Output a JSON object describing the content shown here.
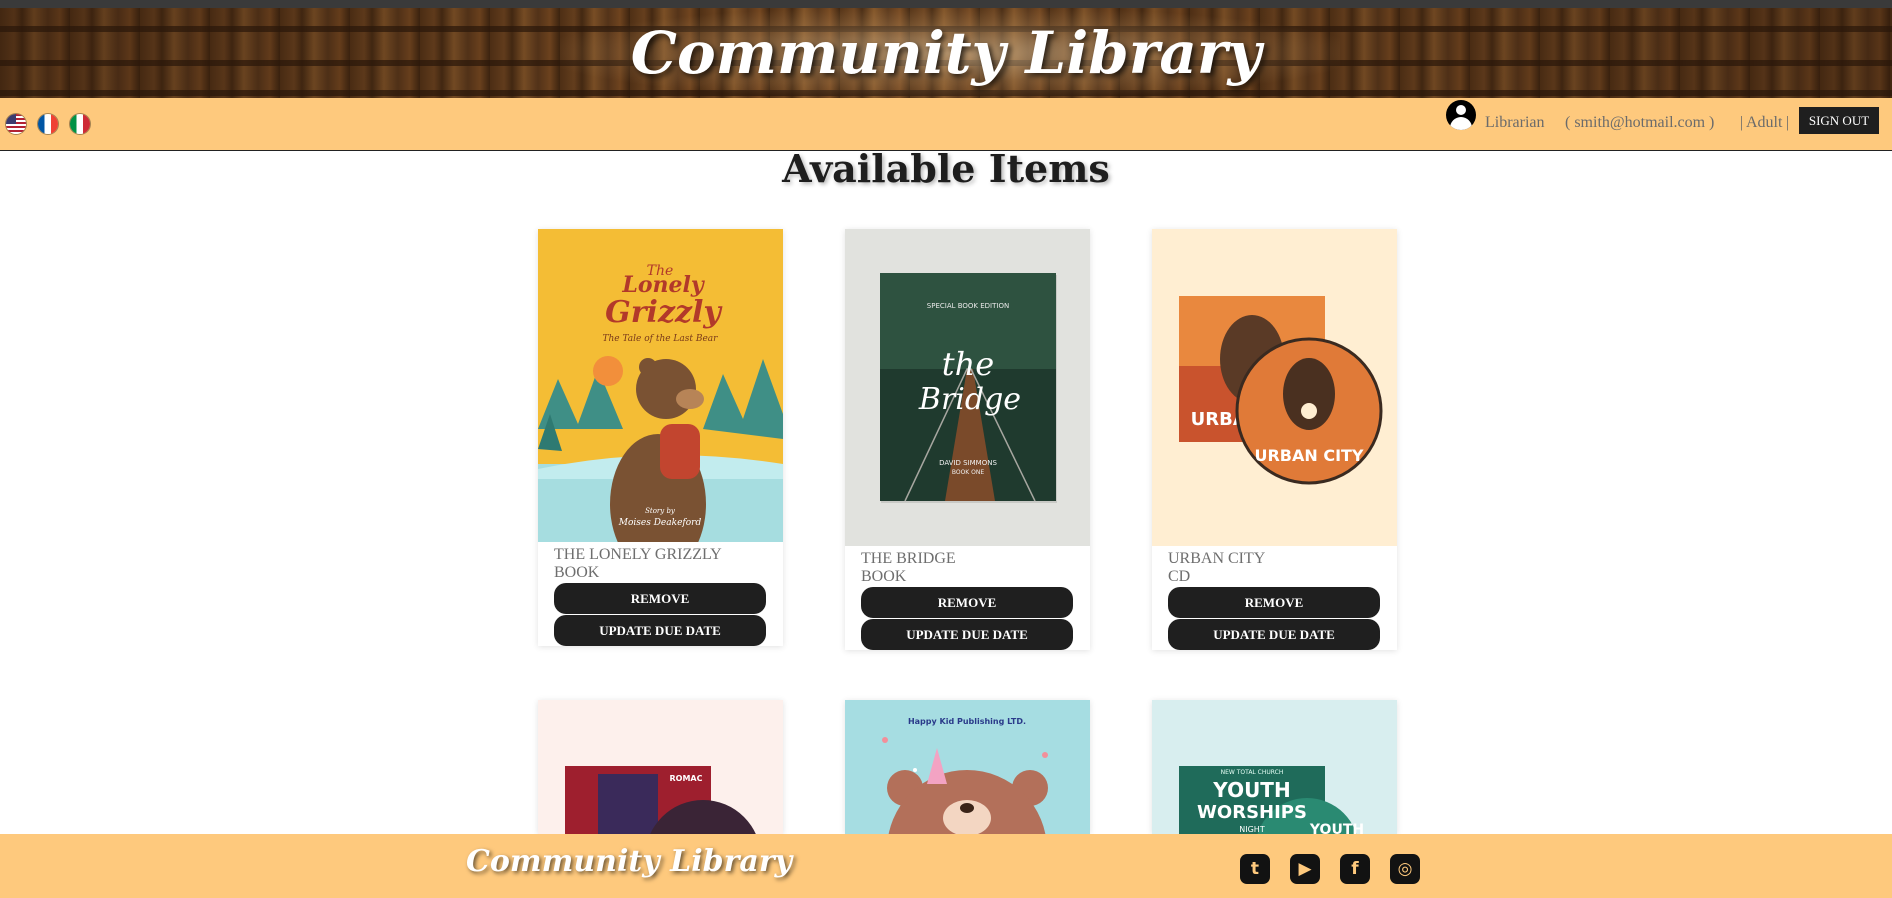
{
  "header": {
    "site_title": "Community Library"
  },
  "navbar": {
    "languages": [
      "English",
      "French",
      "Italian"
    ],
    "role": "Librarian",
    "email": "( smith@hotmail.com )",
    "separator_left": "|",
    "age_group": "Adult",
    "separator_right": "|",
    "sign_out_label": "SIGN OUT"
  },
  "main": {
    "section_title": "Available Items",
    "items": [
      {
        "title": "THE LONELY GRIZZLY",
        "type": "BOOK",
        "remove_label": "REMOVE",
        "update_label": "UPDATE DUE DATE",
        "cover": {
          "small": "The",
          "big1": "Lonely",
          "big2": "Grizzly",
          "subtitle": "The Tale of the Last Bear",
          "byline": "Story by",
          "author": "Moises Deakeford"
        }
      },
      {
        "title": "THE BRIDGE",
        "type": "BOOK",
        "remove_label": "REMOVE",
        "update_label": "UPDATE DUE DATE",
        "cover": {
          "edition": "SPECIAL BOOK EDITION",
          "script1": "the",
          "script2": "Bridge",
          "author": "DAVID SIMMONS",
          "sub": "BOOK ONE"
        }
      },
      {
        "title": "URBAN CITY",
        "type": "CD",
        "remove_label": "REMOVE",
        "update_label": "UPDATE DUE DATE",
        "cover": {
          "case_text": "URBAN CITY",
          "disc_text": "URBAN CITY"
        }
      },
      {
        "title": "",
        "type": "",
        "cover": {
          "label": "ROMAC"
        }
      },
      {
        "title": "",
        "type": "",
        "cover": {
          "publisher": "Happy Kid Publishing LTD."
        }
      },
      {
        "title": "",
        "type": "",
        "cover": {
          "line1": "NEW TOTAL CHURCH",
          "line2": "YOUTH",
          "line3": "WORSHIPS",
          "line4": "NIGHT",
          "disc": "YOUTH"
        }
      }
    ]
  },
  "footer": {
    "site_title": "Community Library",
    "social": [
      {
        "name": "Twitter",
        "glyph": "t"
      },
      {
        "name": "YouTube",
        "glyph": "▶"
      },
      {
        "name": "Facebook",
        "glyph": "f"
      },
      {
        "name": "Instagram",
        "glyph": "◎"
      }
    ]
  },
  "colors": {
    "navbar_bg": "#fec97d",
    "button_bg": "#1f1f1f",
    "text_muted": "#6e6e6e"
  }
}
